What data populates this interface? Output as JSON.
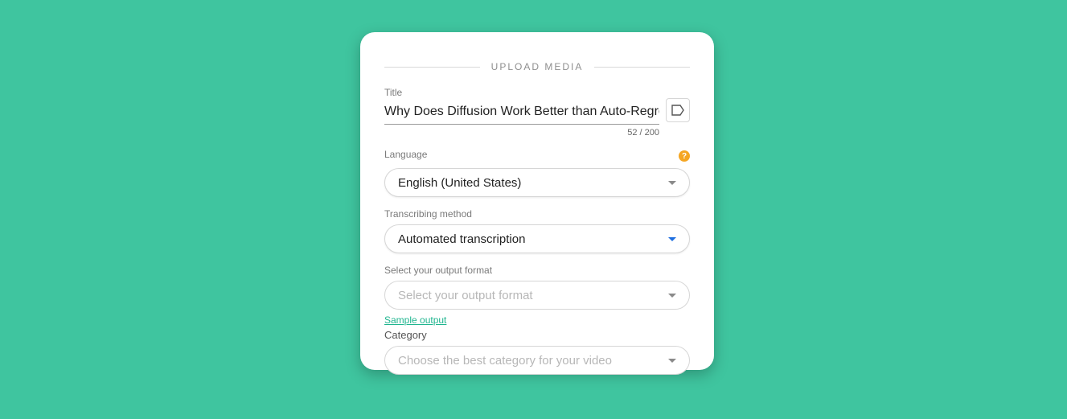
{
  "header": "UPLOAD MEDIA",
  "title": {
    "label": "Title",
    "value": "Why Does Diffusion Work Better than Auto-Regression",
    "count": "52 / 200"
  },
  "language": {
    "label": "Language",
    "value": "English (United States)"
  },
  "method": {
    "label": "Transcribing method",
    "value": "Automated transcription"
  },
  "output": {
    "label": "Select your output format",
    "placeholder": "Select your output format",
    "sample": "Sample output"
  },
  "category": {
    "label": "Category",
    "placeholder": "Choose the best category for your video"
  }
}
